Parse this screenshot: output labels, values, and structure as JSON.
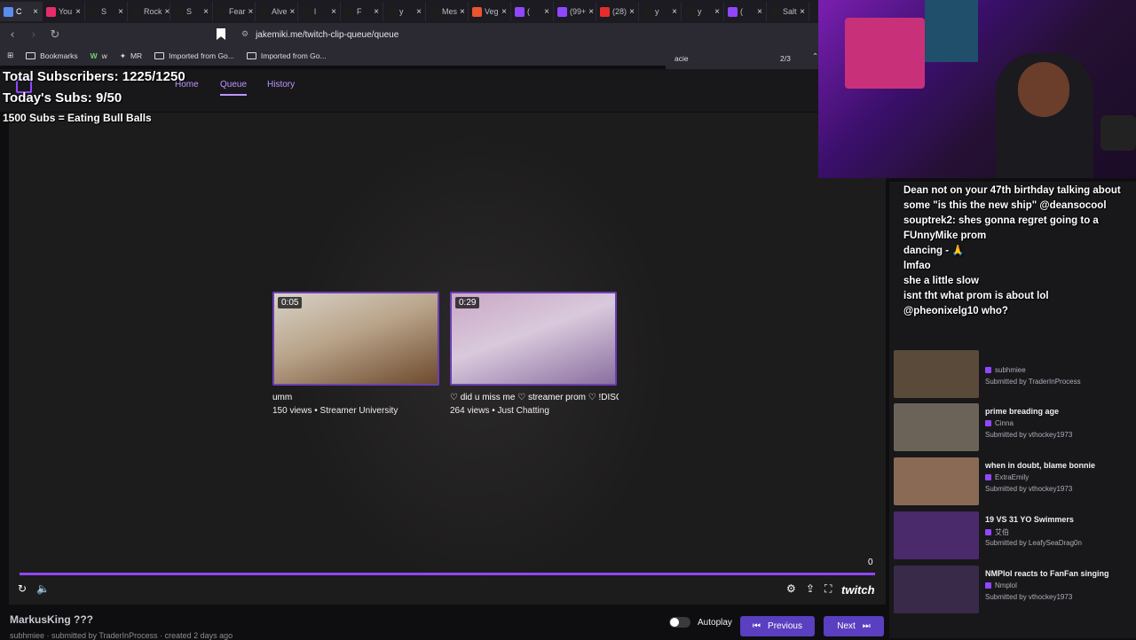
{
  "browser": {
    "tabs": [
      {
        "label": "C",
        "favicon_color": "#5b8def"
      },
      {
        "label": "You",
        "favicon_color": "#e52d6c"
      },
      {
        "label": "S",
        "favicon_color": "#1d1d1d"
      },
      {
        "label": "Rock",
        "favicon_color": "#1d1d1d"
      },
      {
        "label": "S",
        "favicon_color": "#1d1d1d"
      },
      {
        "label": "Fear",
        "favicon_color": "#1d1d1d"
      },
      {
        "label": "Alve",
        "favicon_color": "#1d1d1d"
      },
      {
        "label": "l",
        "favicon_color": "#1d1d1d"
      },
      {
        "label": "F",
        "favicon_color": "#1d1d1d"
      },
      {
        "label": "y",
        "favicon_color": "#1d1d1d"
      },
      {
        "label": "Mes",
        "favicon_color": "#1d1d1d"
      },
      {
        "label": "Veg",
        "favicon_color": "#e8552f"
      },
      {
        "label": "(",
        "favicon_color": "#9147ff"
      },
      {
        "label": "(99+",
        "favicon_color": "#9147ff"
      },
      {
        "label": "(28)",
        "favicon_color": "#e52d2d"
      },
      {
        "label": "y",
        "favicon_color": "#1d1d1d"
      },
      {
        "label": "y",
        "favicon_color": "#1d1d1d"
      },
      {
        "label": "(",
        "favicon_color": "#9147ff"
      },
      {
        "label": "Salt",
        "favicon_color": "#1d1d1d"
      }
    ],
    "url": "jakemiki.me/twitch-clip-queue/queue",
    "bookmarks": [
      "Bookmarks",
      "w",
      "MR",
      "Imported from Go...",
      "Imported from Go..."
    ],
    "find": {
      "query": "acie",
      "count": "2/3"
    }
  },
  "overlay": {
    "total_subs": "Total Subscribers: 1225/1250",
    "today_subs": "Today's Subs: 9/50",
    "goal": "1500 Subs = Eating Bull Balls"
  },
  "app": {
    "nav": {
      "home": "Home",
      "queue": "Queue",
      "history": "History"
    }
  },
  "player": {
    "clips": [
      {
        "duration": "0:05",
        "title": "umm",
        "meta": "150 views • Streamer University"
      },
      {
        "duration": "0:29",
        "title": "♡ did u miss me ♡ streamer prom ♡ !DISC...",
        "meta": "264 views • Just Chatting"
      }
    ],
    "countdown": "0",
    "twitch_logo": "twitch"
  },
  "current": {
    "title": "MarkusKing ???",
    "subtitle": "subhmiee · submitted by TraderInProcess · created 2 days ago"
  },
  "controls": {
    "autoplay": "Autoplay",
    "previous": "Previous",
    "next": "Next"
  },
  "queue": [
    {
      "title": "",
      "channel": "subhmiee",
      "submitted": "Submitted by TraderInProcess",
      "color": "#5a4a3a"
    },
    {
      "title": "prime breading age",
      "channel": "Cinna",
      "submitted": "Submitted by vthockey1973",
      "color": "#6b6357"
    },
    {
      "title": "when in doubt, blame bonnie",
      "channel": "ExtraEmily",
      "submitted": "Submitted by vthockey1973",
      "color": "#8a6a55"
    },
    {
      "title": "19 VS 31 YO Swimmers",
      "channel": "艾伯",
      "submitted": "Submitted by LeafySeaDrag0n",
      "color": "#4a2a6b"
    },
    {
      "title": "NMPlol reacts to FanFan singing",
      "channel": "Nmplol",
      "submitted": "Submitted by vthockey1973",
      "color": "#3a2a4a"
    }
  ],
  "chat": [
    {
      "user": "",
      "text": "Dean not on your 47th birthday talking about some \"is this the new ship\" @deansocool"
    },
    {
      "user": "",
      "text": "souptrek2: shes gonna regret going to a FUnnyMike prom"
    },
    {
      "user": "",
      "text": "dancing - 🙏"
    },
    {
      "user": "",
      "text": "lmfao"
    },
    {
      "user": "",
      "text": "she a little slow"
    },
    {
      "user": "",
      "text": "isnt tht what prom is about lol"
    },
    {
      "user": "",
      "text": "@pheonixelg10 who?"
    }
  ]
}
